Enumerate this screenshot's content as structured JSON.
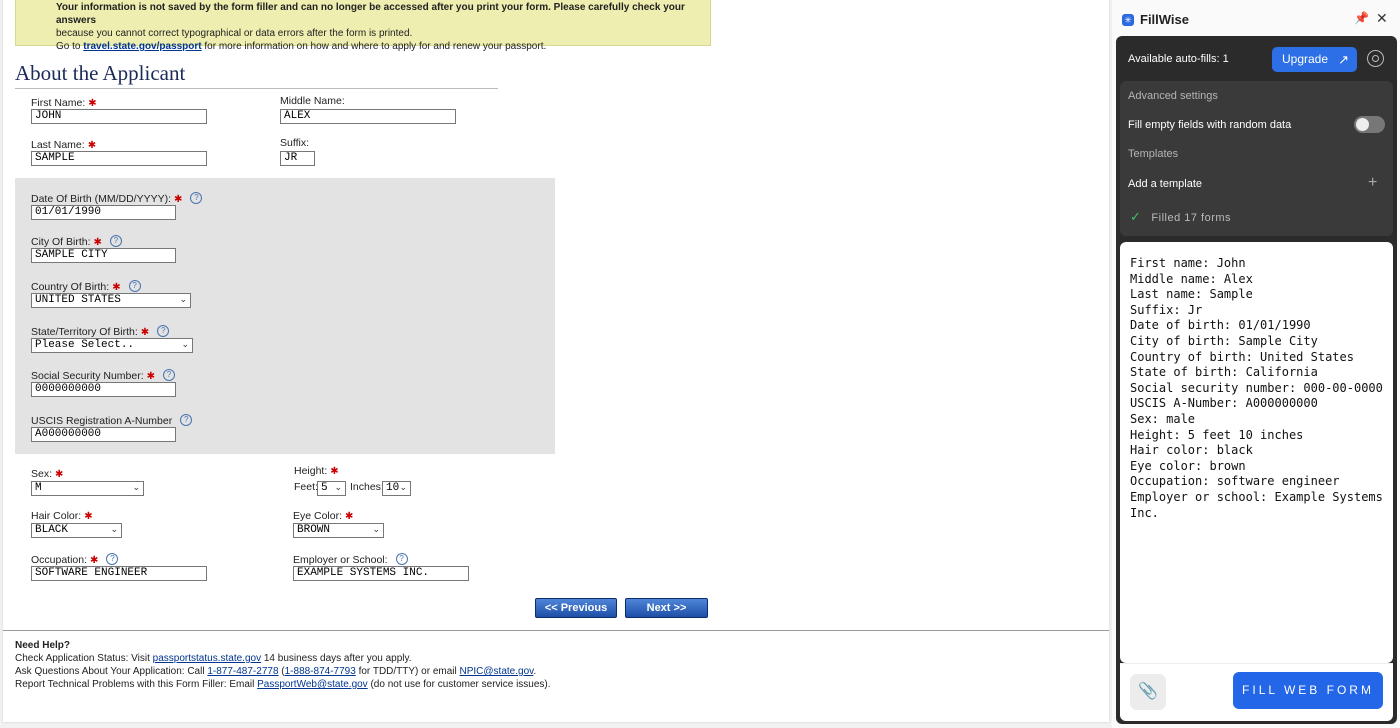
{
  "notice": {
    "line1_strong": "Your information is not saved by the form filler and can no longer be accessed after you print your form. Please carefully check your answers",
    "line2": "because you cannot correct typographical or data errors after the form is printed.",
    "line3_pre": "Go to ",
    "line3_link": "travel.state.gov/passport",
    "line3_post": " for more information on how and where to apply for and renew your passport."
  },
  "section_title": "About the Applicant",
  "fields": {
    "first_name": {
      "label": "First Name:",
      "value": "JOHN"
    },
    "middle_name": {
      "label": "Middle Name:",
      "value": "ALEX"
    },
    "last_name": {
      "label": "Last Name:",
      "value": "SAMPLE"
    },
    "suffix": {
      "label": "Suffix:",
      "value": "JR"
    },
    "dob": {
      "label": "Date Of Birth (MM/DD/YYYY):",
      "value": "01/01/1990"
    },
    "city_birth": {
      "label": "City Of Birth:",
      "value": "SAMPLE CITY"
    },
    "country_birth": {
      "label": "Country Of Birth:",
      "value": "UNITED STATES"
    },
    "state_birth": {
      "label": "State/Territory Of Birth:",
      "value": "Please Select.."
    },
    "ssn": {
      "label": "Social Security Number:",
      "value": "0000000000"
    },
    "uscis": {
      "label": "USCIS Registration A-Number",
      "value": "A000000000"
    },
    "sex": {
      "label": "Sex:",
      "value": "M"
    },
    "height": {
      "label": "Height:",
      "feet_label": "Feet:",
      "feet": "5",
      "inches_label": "Inches:",
      "inches": "10"
    },
    "hair": {
      "label": "Hair Color:",
      "value": "BLACK"
    },
    "eye": {
      "label": "Eye Color:",
      "value": "BROWN"
    },
    "occupation": {
      "label": "Occupation:",
      "value": "SOFTWARE ENGINEER"
    },
    "employer": {
      "label": "Employer or School:",
      "value": "EXAMPLE SYSTEMS INC."
    }
  },
  "nav": {
    "previous": "<< Previous",
    "next": "Next >>"
  },
  "footer": {
    "title": "Need Help?",
    "l1_pre": "Check Application Status: Visit ",
    "l1_link": "passportstatus.state.gov",
    "l1_post": " 14 business days after you apply.",
    "l2_pre": "Ask Questions About Your Application: Call ",
    "l2_link1": "1-877-487-2778",
    "l2_mid1": " (",
    "l2_link2": "1-888-874-7793",
    "l2_mid2": " for TDD/TTY) or email ",
    "l2_link3": "NPIC@state.gov",
    "l2_post": ".",
    "l3_pre": "Report Technical Problems with this Form Filler: Email ",
    "l3_link": "PassportWeb@state.gov",
    "l3_post": " (do not use for customer service issues)."
  },
  "ext": {
    "name": "FillWise",
    "available": "Available auto-fills: 1",
    "upgrade": "Upgrade",
    "advanced": "Advanced settings",
    "fill_empty": "Fill empty fields with random data",
    "templates": "Templates",
    "add_template": "Add a template",
    "filled": "Filled 17 forms",
    "text": "First name: John\nMiddle name: Alex\nLast name: Sample\nSuffix: Jr\nDate of birth: 01/01/1990\nCity of birth: Sample City\nCountry of birth: United States\nState of birth: California\nSocial security number: 000-00-0000\nUSCIS A-Number: A000000000\nSex: male\nHeight: 5 feet 10 inches\nHair color: black\nEye color: brown\nOccupation: software engineer\nEmployer or school: Example Systems Inc.",
    "fill_button": "FILL WEB FORM"
  }
}
